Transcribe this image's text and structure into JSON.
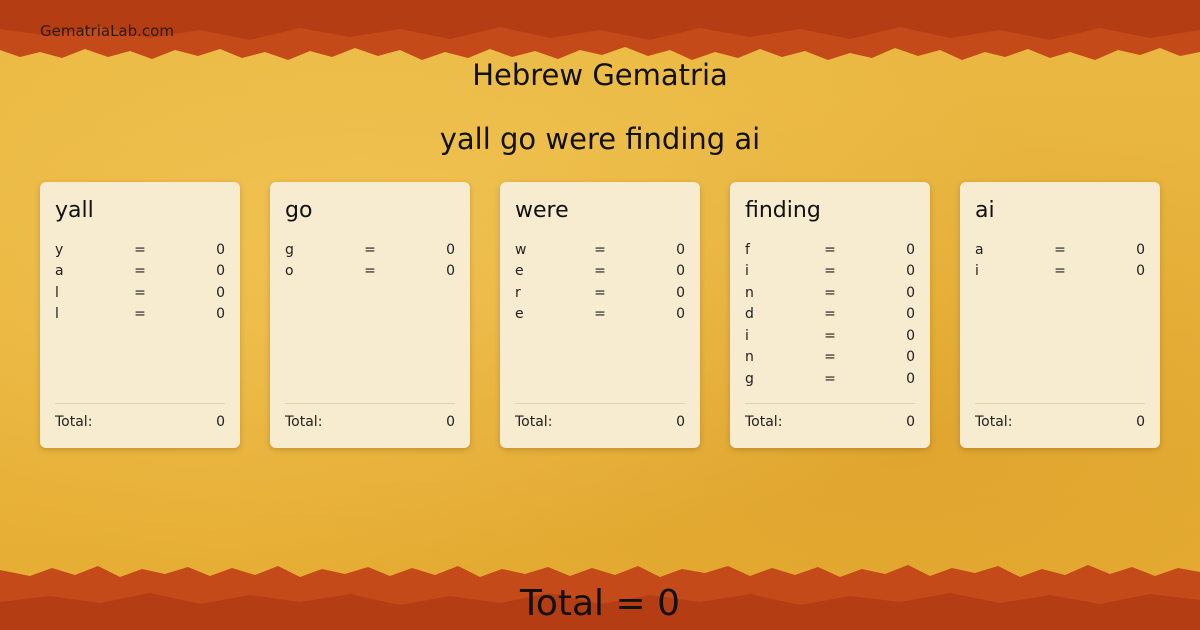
{
  "site": "GematriaLab.com",
  "title": "Hebrew Gematria",
  "phrase": "yall go were finding ai",
  "colors": {
    "band": "#c54a19",
    "background": "#e8b53e",
    "card": "#f7ebd0"
  },
  "words": [
    {
      "word": "yall",
      "letters": [
        {
          "ch": "y",
          "eq": "=",
          "val": "0"
        },
        {
          "ch": "a",
          "eq": "=",
          "val": "0"
        },
        {
          "ch": "l",
          "eq": "=",
          "val": "0"
        },
        {
          "ch": "l",
          "eq": "=",
          "val": "0"
        }
      ],
      "total_label": "Total:",
      "total": "0"
    },
    {
      "word": "go",
      "letters": [
        {
          "ch": "g",
          "eq": "=",
          "val": "0"
        },
        {
          "ch": "o",
          "eq": "=",
          "val": "0"
        }
      ],
      "total_label": "Total:",
      "total": "0"
    },
    {
      "word": "were",
      "letters": [
        {
          "ch": "w",
          "eq": "=",
          "val": "0"
        },
        {
          "ch": "e",
          "eq": "=",
          "val": "0"
        },
        {
          "ch": "r",
          "eq": "=",
          "val": "0"
        },
        {
          "ch": "e",
          "eq": "=",
          "val": "0"
        }
      ],
      "total_label": "Total:",
      "total": "0"
    },
    {
      "word": "finding",
      "letters": [
        {
          "ch": "f",
          "eq": "=",
          "val": "0"
        },
        {
          "ch": "i",
          "eq": "=",
          "val": "0"
        },
        {
          "ch": "n",
          "eq": "=",
          "val": "0"
        },
        {
          "ch": "d",
          "eq": "=",
          "val": "0"
        },
        {
          "ch": "i",
          "eq": "=",
          "val": "0"
        },
        {
          "ch": "n",
          "eq": "=",
          "val": "0"
        },
        {
          "ch": "g",
          "eq": "=",
          "val": "0"
        }
      ],
      "total_label": "Total:",
      "total": "0"
    },
    {
      "word": "ai",
      "letters": [
        {
          "ch": "a",
          "eq": "=",
          "val": "0"
        },
        {
          "ch": "i",
          "eq": "=",
          "val": "0"
        }
      ],
      "total_label": "Total:",
      "total": "0"
    }
  ],
  "grand_total": "Total = 0"
}
